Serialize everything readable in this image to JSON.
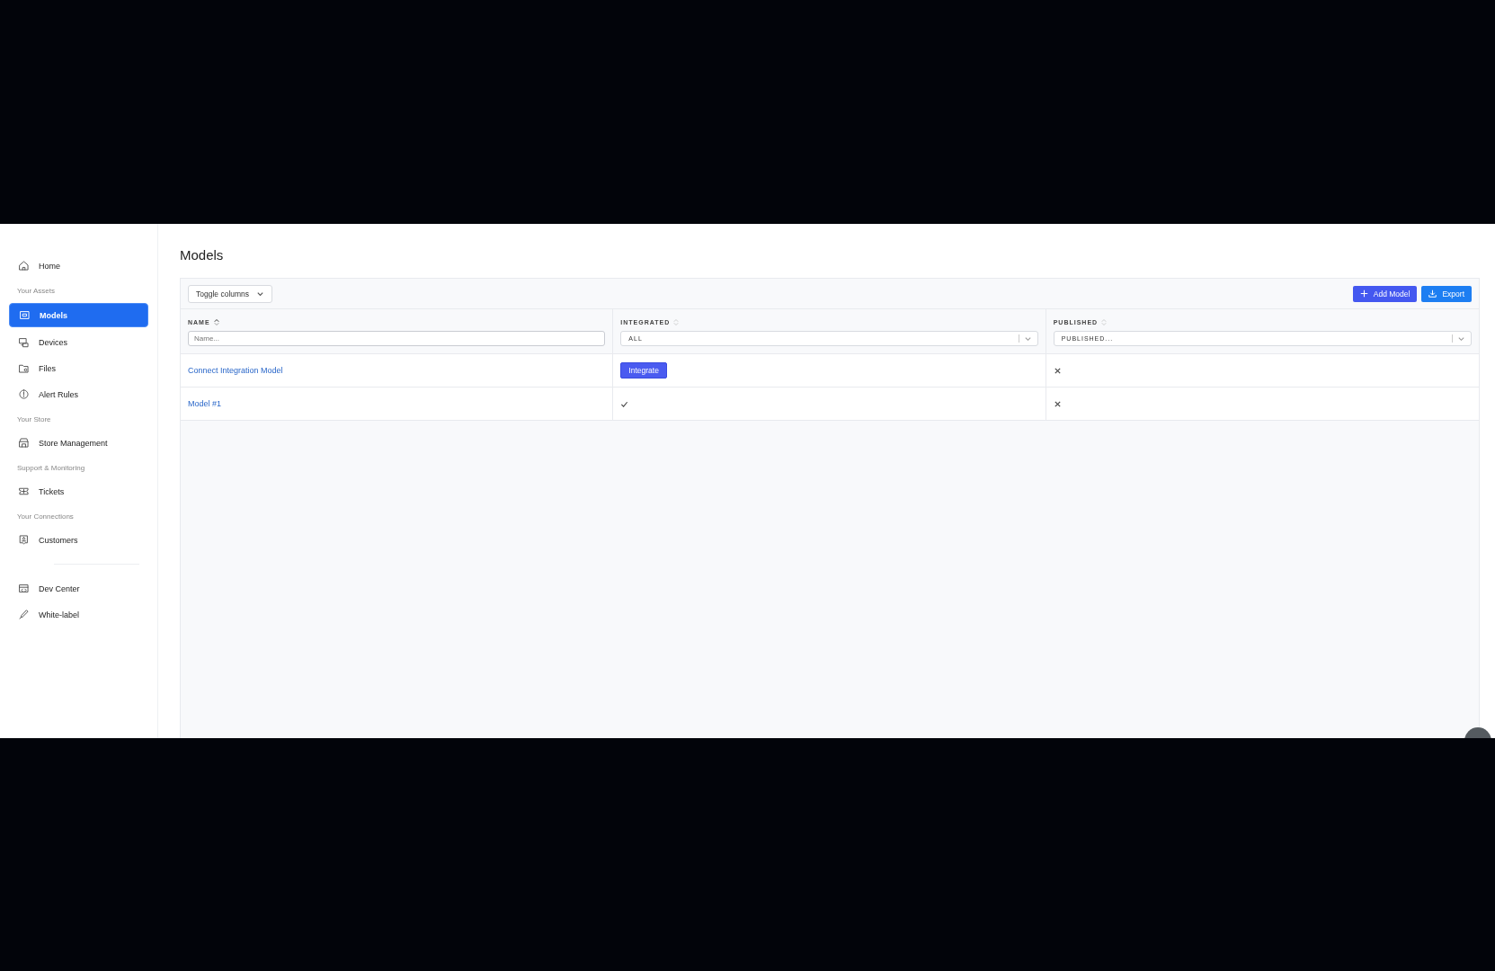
{
  "sidebar": {
    "items": [
      {
        "kind": "link",
        "label": "Home",
        "selected": false
      },
      {
        "kind": "heading",
        "label": "Your Assets"
      },
      {
        "kind": "link",
        "label": "Models",
        "selected": true
      },
      {
        "kind": "link",
        "label": "Devices",
        "selected": false
      },
      {
        "kind": "link",
        "label": "Files",
        "selected": false
      },
      {
        "kind": "link",
        "label": "Alert Rules",
        "selected": false
      },
      {
        "kind": "heading",
        "label": "Your Store"
      },
      {
        "kind": "link",
        "label": "Store Management",
        "selected": false
      },
      {
        "kind": "heading",
        "label": "Support & Monitoring"
      },
      {
        "kind": "link",
        "label": "Tickets",
        "selected": false
      },
      {
        "kind": "heading",
        "label": "Your Connections"
      },
      {
        "kind": "link",
        "label": "Customers",
        "selected": false
      },
      {
        "kind": "divider"
      },
      {
        "kind": "link",
        "label": "Dev Center",
        "selected": false
      },
      {
        "kind": "link",
        "label": "White-label",
        "selected": false
      }
    ]
  },
  "page": {
    "title": "Models"
  },
  "toolbar": {
    "toggle": "Toggle columns",
    "buttons": [
      {
        "kind": "add",
        "label": "Add Model"
      },
      {
        "kind": "export",
        "label": "Export"
      }
    ]
  },
  "table": {
    "columns": [
      {
        "label": "NAME",
        "sorted": true,
        "filter": {
          "kind": "text",
          "placeholder": "Name..."
        }
      },
      {
        "label": "INTEGRATED",
        "sorted": false,
        "filter": {
          "kind": "select",
          "value": "ALL"
        }
      },
      {
        "label": "PUBLISHED",
        "sorted": false,
        "filter": {
          "kind": "select",
          "value": "PUBLISHED..."
        }
      }
    ],
    "rows": [
      {
        "name": "Connect Integration Model",
        "integrated": {
          "kind": "button",
          "label": "Integrate"
        },
        "published": {
          "kind": "cross"
        }
      },
      {
        "name": "Model #1",
        "integrated": {
          "kind": "check"
        },
        "published": {
          "kind": "cross"
        }
      }
    ]
  }
}
